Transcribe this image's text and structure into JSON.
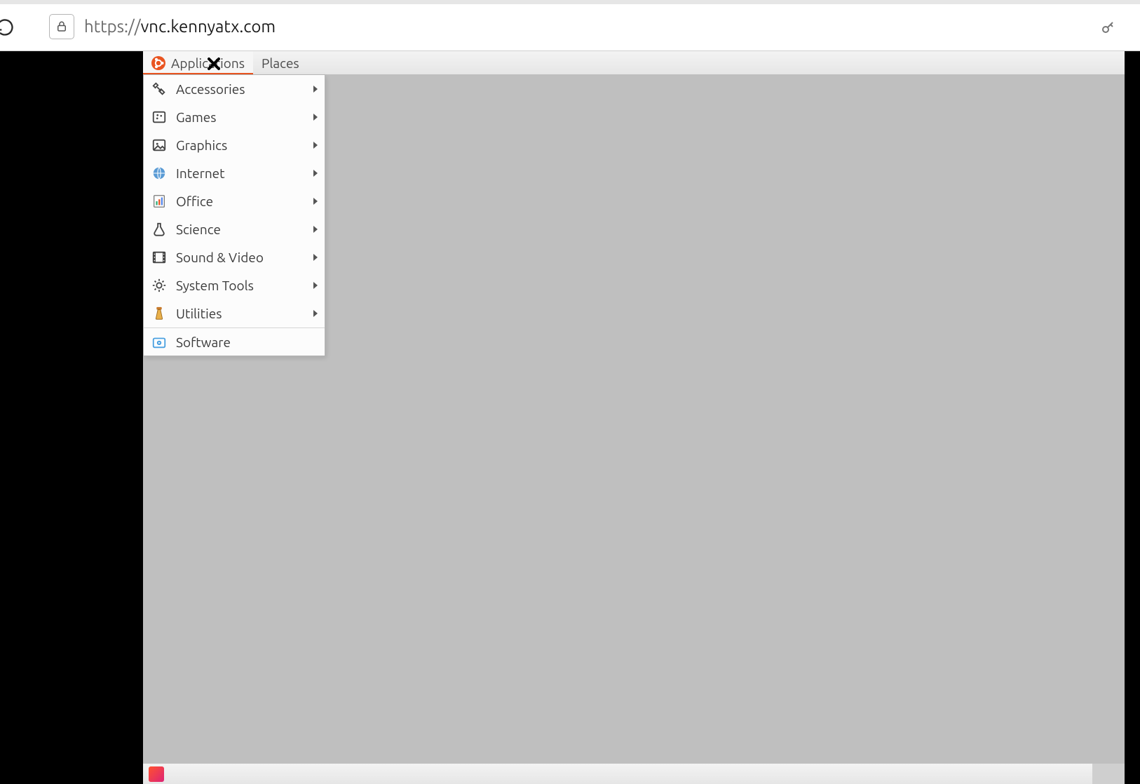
{
  "browser": {
    "url_scheme": "https://",
    "url_host": "vnc.kennyatx.com"
  },
  "panel": {
    "applications_label": "Applications",
    "places_label": "Places"
  },
  "menu": {
    "items": [
      {
        "label": "Accessories",
        "icon": "accessories",
        "has_submenu": true
      },
      {
        "label": "Games",
        "icon": "games",
        "has_submenu": true
      },
      {
        "label": "Graphics",
        "icon": "graphics",
        "has_submenu": true
      },
      {
        "label": "Internet",
        "icon": "internet",
        "has_submenu": true
      },
      {
        "label": "Office",
        "icon": "office",
        "has_submenu": true
      },
      {
        "label": "Science",
        "icon": "science",
        "has_submenu": true
      },
      {
        "label": "Sound & Video",
        "icon": "sound-video",
        "has_submenu": true
      },
      {
        "label": "System Tools",
        "icon": "system-tools",
        "has_submenu": true
      },
      {
        "label": "Utilities",
        "icon": "utilities",
        "has_submenu": true
      },
      {
        "label": "Software",
        "icon": "software",
        "has_submenu": false,
        "separator_before": true
      }
    ]
  }
}
